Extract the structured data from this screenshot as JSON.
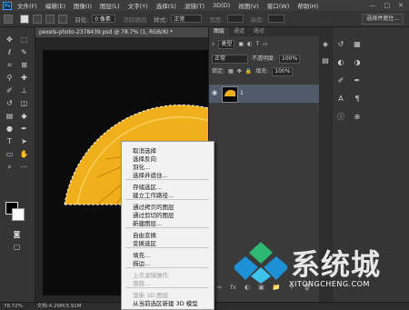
{
  "app": {
    "logo": "Ps"
  },
  "menubar": {
    "items": [
      "文件(F)",
      "编辑(E)",
      "图像(I)",
      "图层(L)",
      "文字(Y)",
      "选择(S)",
      "滤镜(T)",
      "3D(D)",
      "视图(V)",
      "窗口(W)",
      "帮助(H)"
    ],
    "controls": [
      "—",
      "□",
      "✕"
    ]
  },
  "options": {
    "feather_label": "羽化:",
    "feather_value": "0 像素",
    "antialias_label": "消除锯齿",
    "style_label": "样式:",
    "style_value": "正常",
    "width_label": "宽度:",
    "height_label": "高度:",
    "select_mask": "选择并遮住..."
  },
  "document": {
    "tab_title": "pexels-photo-2378439.psd @ 78.7% (1, RGB/8) *",
    "zoom": "78.72%",
    "doc_size": "文档:4.29M/3.91M"
  },
  "layers_panel": {
    "tabs": [
      "图层",
      "通道",
      "路径"
    ],
    "filter": "类型",
    "blend_mode": "正常",
    "opacity_label": "不透明度:",
    "opacity_value": "100%",
    "lock_label": "锁定:",
    "fill_label": "填充:",
    "fill_value": "100%",
    "layer_name": "1",
    "footer_icons": [
      "∞",
      "fx",
      "◐",
      "▣",
      "📁",
      "＋",
      "🗑"
    ]
  },
  "context_menu": {
    "items": [
      {
        "label": "取消选择",
        "disabled": false
      },
      {
        "label": "选择反向",
        "disabled": false
      },
      {
        "label": "羽化...",
        "disabled": false
      },
      {
        "label": "选择并遮住...",
        "disabled": false
      },
      {
        "label": "存储选区...",
        "disabled": false
      },
      {
        "label": "建立工作路径...",
        "disabled": false
      },
      {
        "label": "通过拷贝的图层",
        "disabled": false
      },
      {
        "label": "通过剪切的图层",
        "disabled": false
      },
      {
        "label": "新建图层...",
        "disabled": false
      },
      {
        "label": "自由变换",
        "disabled": false
      },
      {
        "label": "变换选区",
        "disabled": false
      },
      {
        "label": "填充...",
        "disabled": false
      },
      {
        "label": "描边...",
        "disabled": false
      },
      {
        "label": "上次滤镜操作",
        "disabled": true
      },
      {
        "label": "渐隐...",
        "disabled": true
      },
      {
        "label": "渲染 3D 图层",
        "disabled": true
      },
      {
        "label": "从当前选区新建 3D 模型",
        "disabled": false
      }
    ]
  },
  "watermark": {
    "text": "系统城",
    "url": "XITONGCHENG.COM"
  },
  "colors": {
    "accent": "#33a3ff",
    "lemon": "#e8a10c",
    "watermark_blue": "#1e90d6",
    "watermark_green": "#2eb872"
  }
}
